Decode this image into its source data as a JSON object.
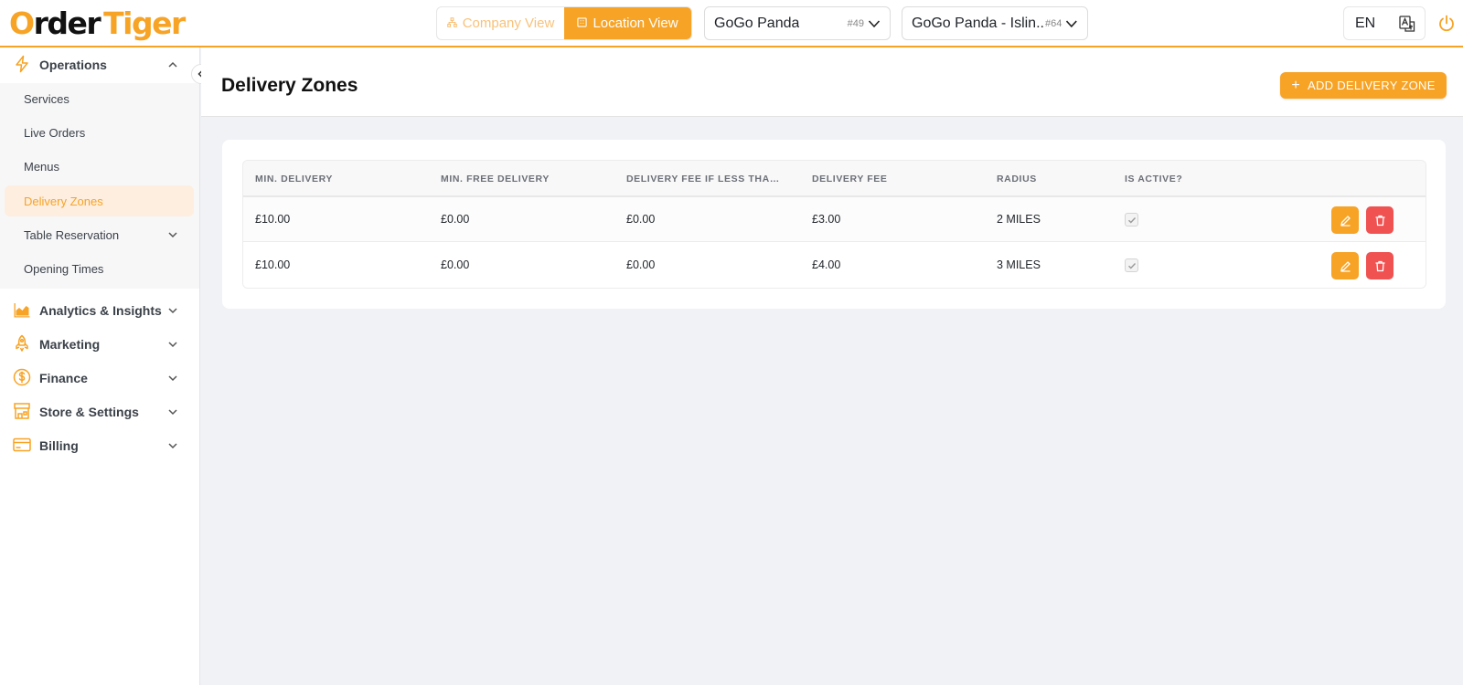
{
  "brand": {
    "logo_o": "O",
    "logo_rder": "rder",
    "logo_tiger": "Tiger"
  },
  "header": {
    "company_view": "Company View",
    "location_view": "Location View",
    "company_select": {
      "label": "GoGo Panda",
      "id": "#49"
    },
    "location_select": {
      "label": "GoGo Panda - Islin...",
      "id": "#64"
    },
    "language": "EN"
  },
  "sidebar": {
    "groups": [
      {
        "label": "Operations",
        "icon": "lightning-icon",
        "expanded": true
      },
      {
        "label": "Analytics & Insights",
        "icon": "chart-icon"
      },
      {
        "label": "Marketing",
        "icon": "rocket-icon"
      },
      {
        "label": "Finance",
        "icon": "dollar-icon"
      },
      {
        "label": "Store & Settings",
        "icon": "store-icon"
      },
      {
        "label": "Billing",
        "icon": "credit-card-icon"
      }
    ],
    "operations_items": [
      {
        "label": "Services"
      },
      {
        "label": "Live Orders"
      },
      {
        "label": "Menus"
      },
      {
        "label": "Delivery Zones",
        "active": true
      },
      {
        "label": "Table Reservation",
        "has_children": true
      },
      {
        "label": "Opening Times"
      }
    ]
  },
  "page": {
    "title": "Delivery Zones",
    "add_button": "ADD DELIVERY ZONE"
  },
  "table": {
    "columns": [
      "MIN. DELIVERY",
      "MIN. FREE DELIVERY",
      "DELIVERY FEE IF LESS THAN ...",
      "DELIVERY FEE",
      "RADIUS",
      "IS ACTIVE?"
    ],
    "rows": [
      {
        "min_delivery": "£10.00",
        "min_free_delivery": "£0.00",
        "fee_if_less": "£0.00",
        "delivery_fee": "£3.00",
        "radius": "2 MILES",
        "is_active": true
      },
      {
        "min_delivery": "£10.00",
        "min_free_delivery": "£0.00",
        "fee_if_less": "£0.00",
        "delivery_fee": "£4.00",
        "radius": "3 MILES",
        "is_active": true
      }
    ]
  },
  "colors": {
    "accent": "#f7a325",
    "danger": "#f05252",
    "active_bg": "#fdeee0"
  }
}
